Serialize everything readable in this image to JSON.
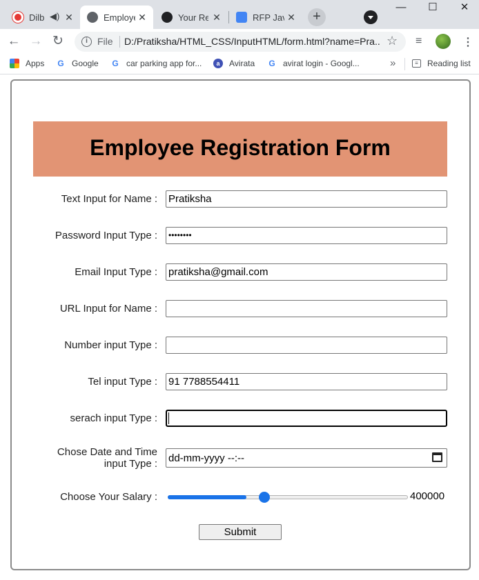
{
  "tabs": [
    {
      "title": "Dilb",
      "favicon_color": "#e53935",
      "has_audio": true
    },
    {
      "title": "Employe",
      "favicon_color": "#5f6368",
      "active": true
    },
    {
      "title": "Your Re",
      "favicon_color": "#202124"
    },
    {
      "title": "RFP Java",
      "favicon_color": "#4285f4"
    }
  ],
  "tab_close_glyph": "✕",
  "new_tab_glyph": "+",
  "window": {
    "minimize": "—",
    "maximize": "☐",
    "close": "✕"
  },
  "toolbar": {
    "back_glyph": "←",
    "forward_glyph": "→",
    "reload_glyph": "↻",
    "info_glyph": "i",
    "file_label": "File",
    "url": "D:/Pratiksha/HTML_CSS/InputHTML/form.html?name=Pra...",
    "star_glyph": "☆",
    "menu_glyph": "⋮",
    "media_glyph": "≡"
  },
  "bookmarks": [
    {
      "label": "Apps",
      "icon": "apps-grid-icon",
      "color": "#ea4335"
    },
    {
      "label": "Google",
      "icon": "google-icon",
      "color": "#4285f4"
    },
    {
      "label": "car parking app for...",
      "icon": "google-icon",
      "color": "#4285f4"
    },
    {
      "label": "Avirata",
      "icon": "avirata-icon",
      "color": "#3f51b5"
    },
    {
      "label": "avirat login - Googl...",
      "icon": "google-icon",
      "color": "#4285f4"
    }
  ],
  "bookmarks_more": "»",
  "reading_list": "Reading list",
  "form": {
    "title": "Employee Registration Form",
    "banner_color": "#e29474",
    "fields": {
      "name": {
        "label": "Text Input for Name :",
        "value": "Pratiksha"
      },
      "password": {
        "label": "Password Input Type :",
        "value": "••••••••"
      },
      "email": {
        "label": "Email Input Type :",
        "value": "pratiksha@gmail.com"
      },
      "url": {
        "label": "URL Input for Name :",
        "value": ""
      },
      "number": {
        "label": "Number input Type :",
        "value": ""
      },
      "tel": {
        "label": "Tel input Type :",
        "value": "91 7788554411"
      },
      "search": {
        "label": "serach input Type :",
        "value": ""
      },
      "datetime": {
        "label_line1": "Chose Date and Time",
        "label_line2": "input Type :",
        "value": "dd-mm-yyyy --:--"
      },
      "salary": {
        "label": "Choose Your Salary :",
        "value": "400000",
        "fraction": 0.5,
        "accent": "#1a73e8"
      }
    },
    "submit_label": "Submit"
  }
}
